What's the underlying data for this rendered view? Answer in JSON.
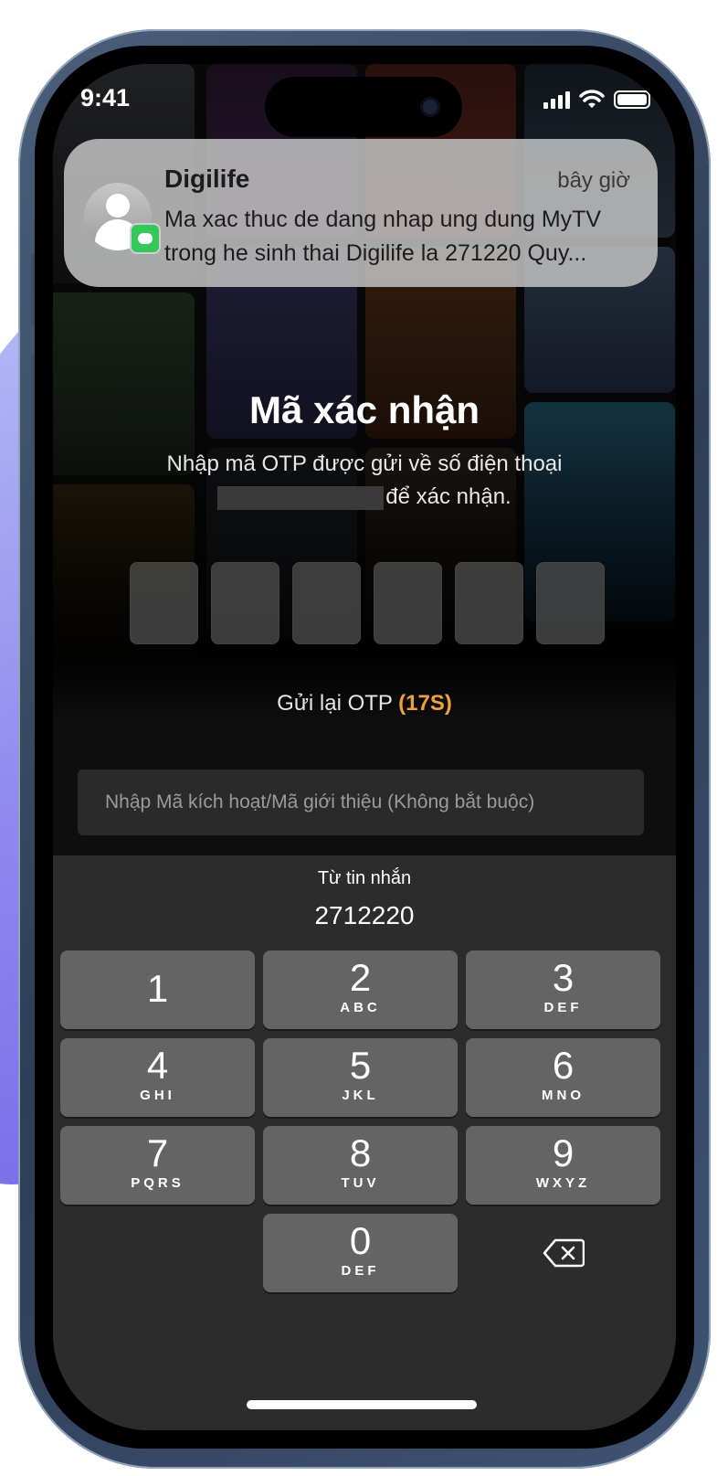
{
  "status_bar": {
    "time": "9:41"
  },
  "notification": {
    "app_name": "Digilife",
    "time": "bây giờ",
    "message": "Ma xac thuc de dang nhap ung dung MyTV trong he sinh thai Digilife la 271220 Quy..."
  },
  "screen": {
    "title": "Mã xác nhận",
    "subtitle_line1": "Nhập mã OTP được gửi về số điện thoại",
    "subtitle_line2": "để xác nhận.",
    "resend_label": "Gửi lại OTP",
    "resend_countdown": "(17S)",
    "referral_placeholder": "Nhập Mã kích hoạt/Mã giới thiệu (Không bắt buộc)"
  },
  "keyboard": {
    "suggestion_label": "Từ tin nhắn",
    "suggestion_code": "2712220",
    "keys": [
      {
        "num": "1",
        "letters": ""
      },
      {
        "num": "2",
        "letters": "ABC"
      },
      {
        "num": "3",
        "letters": "DEF"
      },
      {
        "num": "4",
        "letters": "GHI"
      },
      {
        "num": "5",
        "letters": "JKL"
      },
      {
        "num": "6",
        "letters": "MNO"
      },
      {
        "num": "7",
        "letters": "PQRS"
      },
      {
        "num": "8",
        "letters": "TUV"
      },
      {
        "num": "9",
        "letters": "WXYZ"
      },
      {
        "num": "0",
        "letters": "DEF"
      }
    ],
    "delete_icon": "delete-backspace-icon"
  },
  "colors": {
    "accent": "#f0a03a",
    "notification_bg": "#bebebe",
    "key_bg": "#646464",
    "keyboard_bg": "#2c2c2c"
  }
}
